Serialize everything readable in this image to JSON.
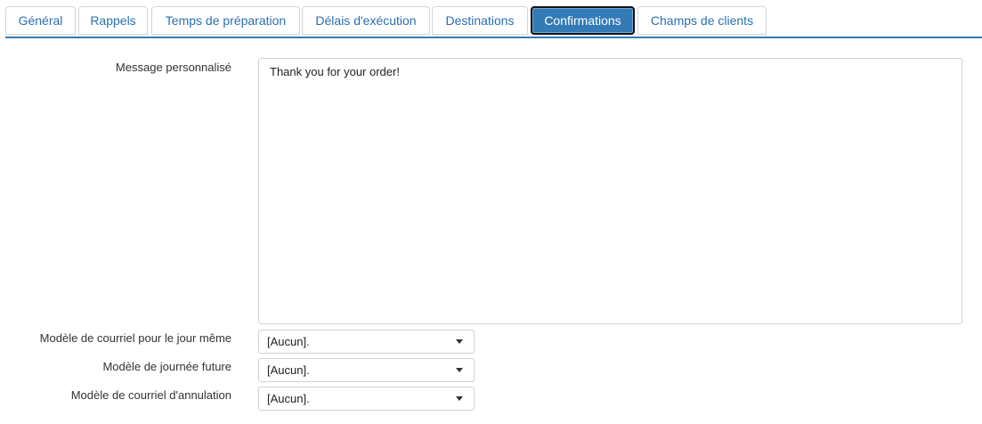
{
  "tabs": [
    {
      "label": "Général"
    },
    {
      "label": "Rappels"
    },
    {
      "label": "Temps de préparation"
    },
    {
      "label": "Délais d'exécution"
    },
    {
      "label": "Destinations"
    },
    {
      "label": "Confirmations"
    },
    {
      "label": "Champs de clients"
    }
  ],
  "active_tab": "Confirmations",
  "form": {
    "message_label": "Message personnalisé",
    "message_value": "Thank you for your order!",
    "same_day_label": "Modèle de courriel pour le jour même",
    "same_day_value": "[Aucun].",
    "future_label": "Modèle de journée future",
    "future_value": "[Aucun].",
    "cancel_label": "Modèle de courriel d'annulation",
    "cancel_value": "[Aucun]."
  },
  "colors": {
    "accent": "#337ab7",
    "tab_text": "#2a6fb0"
  },
  "icons": {
    "dropdown": "caret-down-icon"
  }
}
